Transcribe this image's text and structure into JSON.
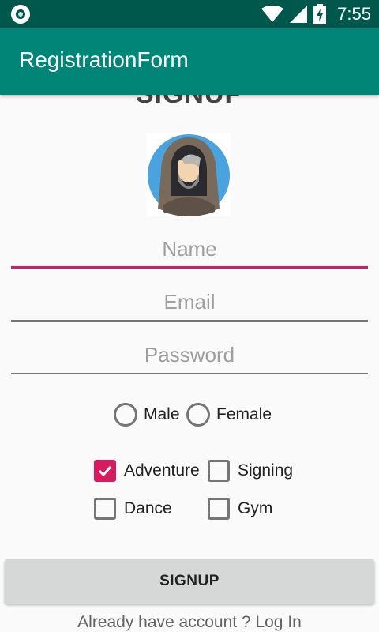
{
  "status_bar": {
    "time": "7:55",
    "icons": [
      "wifi-icon",
      "signal-icon",
      "battery-charging-icon"
    ]
  },
  "app_bar": {
    "title": "RegistrationForm"
  },
  "form": {
    "heading": "SIGNUP",
    "avatar": "hooded-man-avatar",
    "name_placeholder": "Name",
    "email_placeholder": "Email",
    "password_placeholder": "Password",
    "gender_options": [
      {
        "label": "Male",
        "checked": false
      },
      {
        "label": "Female",
        "checked": false
      }
    ],
    "hobbies": [
      {
        "label": "Adventure",
        "checked": true
      },
      {
        "label": "Signing",
        "checked": false
      },
      {
        "label": "Dance",
        "checked": false
      },
      {
        "label": "Gym",
        "checked": false
      }
    ],
    "signup_button": "SIGNUP",
    "login_link": "Already have account ? Log In"
  },
  "colors": {
    "primary": "#008577",
    "primary_dark": "#00574b",
    "accent": "#d81b60"
  }
}
